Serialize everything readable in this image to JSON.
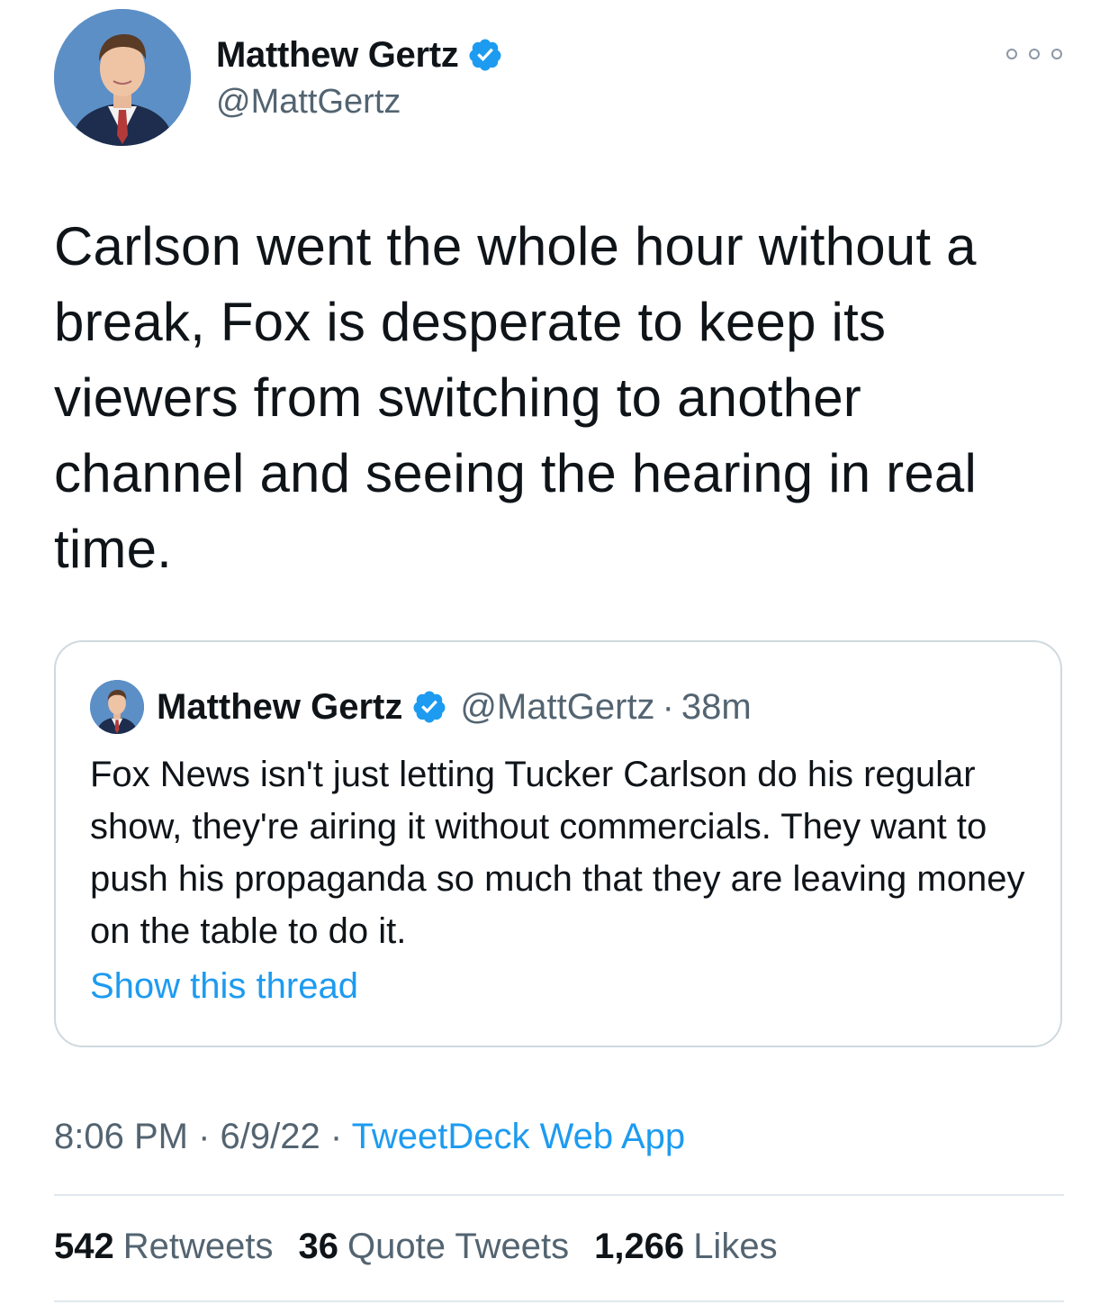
{
  "author": {
    "display_name": "Matthew Gertz",
    "handle": "@MattGertz",
    "verified": true,
    "avatar_icon": "profile-photo"
  },
  "tweet": {
    "text": "Carlson went the whole hour without a break, Fox is desperate to keep its viewers from switching to another channel and seeing the hearing in real time."
  },
  "quoted_tweet": {
    "display_name": "Matthew Gertz",
    "handle": "@MattGertz",
    "separator": "·",
    "time": "38m",
    "text": "Fox News isn't just letting Tucker Carlson do his regular show, they're airing it without commercials. They want to push his propaganda so much that they are leaving money on the table to do it.",
    "show_thread": "Show this thread"
  },
  "meta": {
    "time": "8:06 PM",
    "separator": "·",
    "date": "6/9/22",
    "source": "TweetDeck Web App"
  },
  "stats": {
    "retweets_count": "542",
    "retweets_label": "Retweets",
    "quotes_count": "36",
    "quotes_label": "Quote Tweets",
    "likes_count": "1,266",
    "likes_label": "Likes"
  },
  "colors": {
    "text_primary": "#0f1419",
    "text_secondary": "#536471",
    "link": "#1d9bf0",
    "verified_badge": "#1d9bf0",
    "border": "#cfd9de"
  }
}
